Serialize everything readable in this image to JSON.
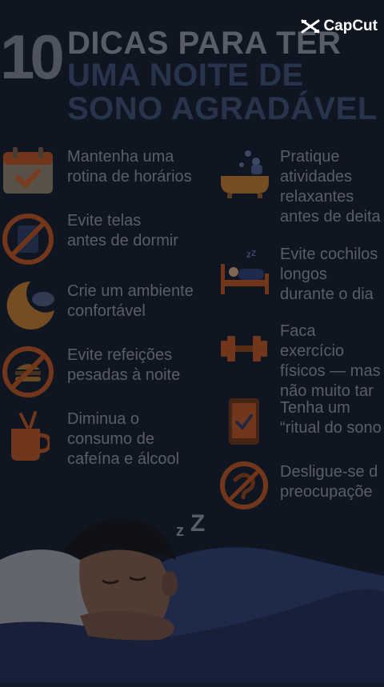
{
  "title": {
    "number": "10",
    "line1": "DICAS PARA TER",
    "line2": "UMA NOITE DE",
    "line3": "SONO AGRADÁVEL"
  },
  "brand": {
    "name": "CapCut",
    "icon": "capcut-logo"
  },
  "tips_left": [
    {
      "text": "Mantenha uma\nrotina de horários",
      "icon": "calendar-icon"
    },
    {
      "text": "Evite telas\nantes de dormir",
      "icon": "no-screen-icon"
    },
    {
      "text": "Crie um ambiente\nconfortável",
      "icon": "moon-icon"
    },
    {
      "text": "Evite refeições\npesadas à noite",
      "icon": "no-burger-icon"
    },
    {
      "text": "Diminua o\nconsumo de\ncafeína e álcool",
      "icon": "coffee-cup-icon"
    }
  ],
  "tips_right": [
    {
      "text": "Pratique\natividades\nrelaxantes\nantes de deita",
      "icon": "bathtub-icon"
    },
    {
      "text": "Evite cochilos\nlongos\ndurante o dia",
      "icon": "bed-nap-icon"
    },
    {
      "text": "Faca exercício\nfísicos — mas\nnão muito tar",
      "icon": "dumbbell-icon"
    },
    {
      "text": "Tenha um\n“ritual do sono",
      "icon": "phone-icon"
    },
    {
      "text": "Desligue-se d\npreocupaçõe",
      "icon": "no-worries-icon"
    }
  ],
  "scene": {
    "zzz": "z Z",
    "icon": "sleeping-man-illustration"
  },
  "colors": {
    "background": "#141a2a",
    "text": "#8b8f98",
    "accent": "#c0561f",
    "title_blue": "#3b4d6e"
  }
}
